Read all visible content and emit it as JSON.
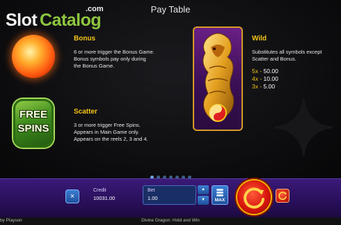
{
  "logo": {
    "part1": "Slot",
    "part2": "Catalog",
    "suffix": ".com"
  },
  "title": "Pay Table",
  "bonus": {
    "heading": "Bonus",
    "lines": [
      "6 or more trigger the Bonus Game.",
      "Bonus symbols pay only during",
      "the Bonus Game."
    ]
  },
  "scatter": {
    "heading": "Scatter",
    "icon_text": [
      "FREE",
      "SPINS"
    ],
    "lines": [
      "3 or more trigger Free Spins.",
      "Appears in Main Game only.",
      "Appears on the reels 2, 3 and 4."
    ]
  },
  "wild": {
    "heading": "Wild",
    "lines": [
      "Substitutes all symbols except",
      "Scatter and Bonus."
    ],
    "pays": [
      {
        "count": "5x",
        "value": "50.00"
      },
      {
        "count": "4x",
        "value": "10.00"
      },
      {
        "count": "3x",
        "value": "5.00"
      }
    ]
  },
  "pagination": {
    "total": 7,
    "active": 0
  },
  "controls": {
    "close_icon": "×",
    "credit_label": "Credit",
    "credit_value": "10031.00",
    "bet_label": "Bet",
    "bet_value": "1.00",
    "max_label": "MAX"
  },
  "footer": {
    "brand": "by Playson",
    "game_name": "Divine Dragon: Hold and Win"
  },
  "colors": {
    "accent": "#f5c518",
    "panel": "#2a105c",
    "button_blue": "#1f4f9a",
    "spin_red": "#d8160c"
  }
}
